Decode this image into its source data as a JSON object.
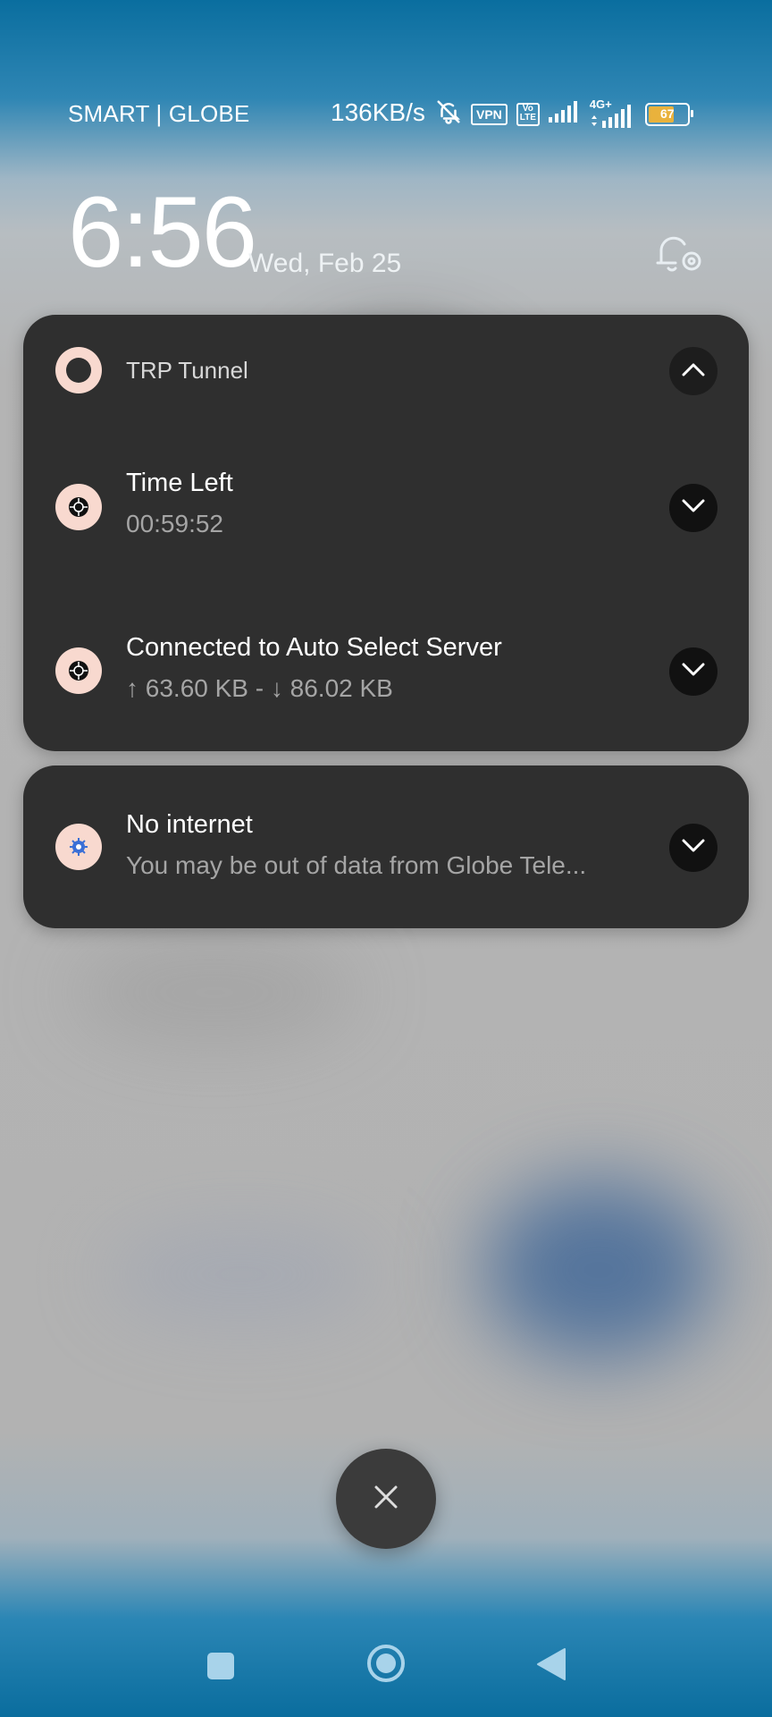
{
  "status_bar": {
    "carrier": "SMART | GLOBE",
    "network_speed": "136KB/s",
    "vpn_badge": "VPN",
    "volte_line1": "Vo",
    "volte_line2": "LTE",
    "network_type": "4G+",
    "battery_level": "67",
    "battery_fraction": 0.67
  },
  "lockscreen": {
    "time": "6:56",
    "date": "Wed, Feb 25"
  },
  "notification_group": {
    "app_name": "TRP Tunnel",
    "items": [
      {
        "title": "Time Left",
        "text": "00:59:52"
      },
      {
        "title": "Connected to Auto Select Server",
        "text": "↑ 63.60 KB - ↓ 86.02 KB"
      }
    ]
  },
  "notification_system": {
    "title": "No internet",
    "text": "You may be out of data from Globe Tele..."
  },
  "colors": {
    "card_bg": "#2f2f2f",
    "icon_bg": "#f8d9cf",
    "accent_blue": "#0a6e9f"
  }
}
